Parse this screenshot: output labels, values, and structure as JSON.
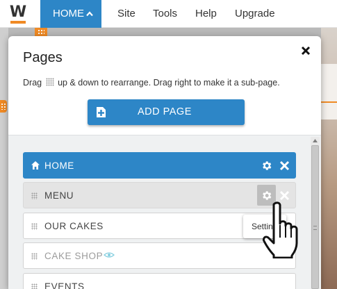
{
  "topnav": {
    "logo_letter": "W",
    "home_label": "HOME",
    "items": [
      {
        "label": "Site"
      },
      {
        "label": "Tools"
      },
      {
        "label": "Help"
      },
      {
        "label": "Upgrade"
      }
    ]
  },
  "panel": {
    "title": "Pages",
    "instructions_before": "Drag",
    "instructions_after": "up & down to rearrange.  Drag right to make it a sub-page.",
    "add_page_label": "ADD PAGE",
    "pages": [
      {
        "label": "HOME",
        "state": "selected"
      },
      {
        "label": "MENU",
        "state": "hover"
      },
      {
        "label": "OUR CAKES",
        "state": "normal"
      },
      {
        "label": "CAKE SHOP",
        "state": "hidden"
      },
      {
        "label": "EVENTS",
        "state": "normal"
      }
    ]
  },
  "tooltip": {
    "text": "Settings"
  },
  "colors": {
    "accent_blue": "#2d86c7",
    "brand_orange": "#f08a24",
    "hover_row": "#e4e4e4",
    "list_background": "#eff1f2"
  },
  "icons": {
    "close": "close-icon",
    "add_page": "add-page-icon",
    "home": "home-icon",
    "gear": "gear-icon",
    "remove": "x-icon",
    "hidden": "eye-icon",
    "cursor": "hand-pointer-icon"
  }
}
